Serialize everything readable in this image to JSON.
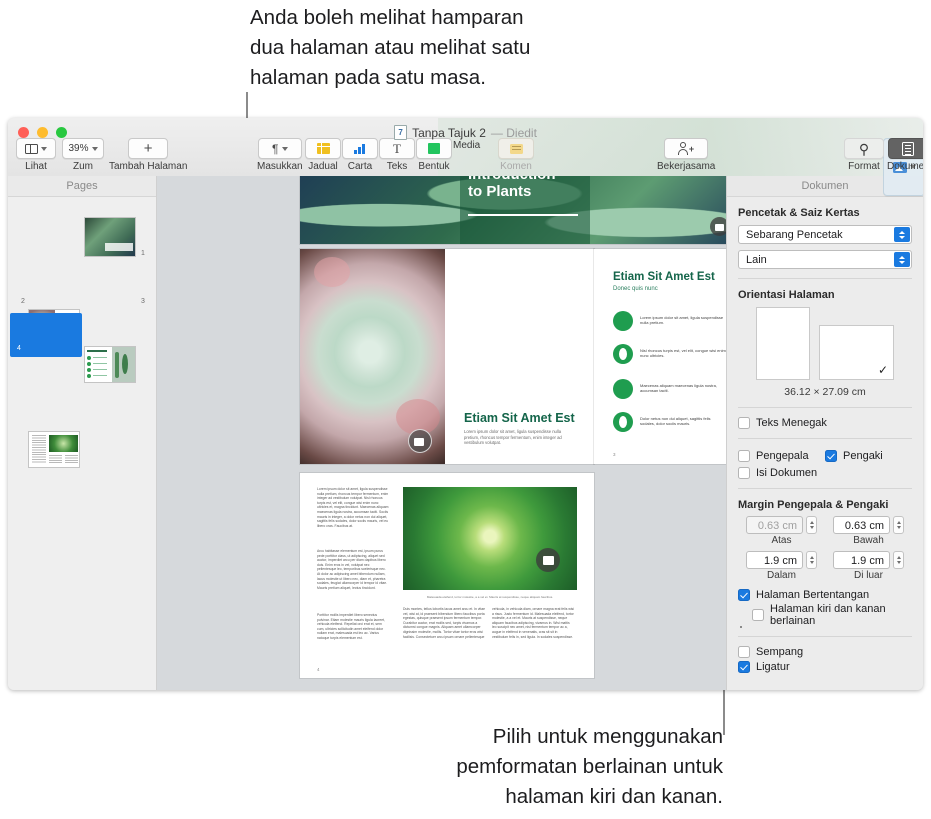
{
  "callouts": {
    "top": "Anda boleh melihat hamparan\ndua halaman atau melihat satu\nhalaman pada satu masa.",
    "bottom": "Pilih untuk menggunakan\npemformatan berlainan untuk\nhalaman kiri dan kanan."
  },
  "window": {
    "title": "Tanpa Tajuk 2",
    "edited": "— Diedit"
  },
  "toolbar": {
    "left": [
      {
        "label": "Lihat",
        "icon": "view-icon",
        "has_chevron": true
      },
      {
        "label": "Zum",
        "icon": "zoom-value",
        "value": "39%",
        "has_chevron": true
      },
      {
        "label": "Tambah Halaman",
        "icon": "plus-icon",
        "has_chevron": false
      }
    ],
    "center": [
      {
        "label": "Masukkan",
        "icon": "paragraph-icon",
        "has_chevron": true
      },
      {
        "label": "Jadual",
        "icon": "table-icon",
        "has_chevron": false
      },
      {
        "label": "Carta",
        "icon": "chart-icon",
        "has_chevron": false
      },
      {
        "label": "Teks",
        "icon": "text-icon",
        "has_chevron": false
      },
      {
        "label": "Bentuk",
        "icon": "shape-icon",
        "has_chevron": false
      },
      {
        "label": "Media",
        "icon": "media-icon",
        "has_chevron": true
      },
      {
        "label": "Komen",
        "icon": "comment-icon",
        "has_chevron": false,
        "disabled": true
      }
    ],
    "collaborate": {
      "label": "Bekerjasama",
      "icon": "collaborate-icon"
    },
    "right": [
      {
        "label": "Format",
        "icon": "format-brush-icon",
        "selected": false
      },
      {
        "label": "Dokumen",
        "icon": "document-icon",
        "selected": true
      }
    ]
  },
  "pages_panel": {
    "header": "Pages",
    "thumbs": [
      {
        "number": "1",
        "selected": false
      },
      {
        "number": "2",
        "selected": false
      },
      {
        "number": "3",
        "selected": false
      },
      {
        "number": "4",
        "selected": true
      }
    ]
  },
  "canvas": {
    "page1_title": "Introduction\nto Plants",
    "spread": {
      "left_heading": "Etiam Sit Amet Est",
      "left_body": "Lorem ipsum dolor sit amet, ligula suspendisse nulla pretium, rhoncus tempor fermentum, enim integer ad vestibulum volutpat.",
      "right_heading": "Etiam Sit Amet Est",
      "right_subheading": "Donec quis nunc",
      "right_bullets": [
        "Lorem ipsum dolor sit amet, ligula suspendisse nulla pretium.",
        "Nisl rhoncus turpis est, vel elit, congue wisi enim nunc ultricies.",
        "Maecenas aliquam maecenas ligula nostra, accumsan taciti.",
        "Dolor netus non dui aliquet, sagittis felis sodales, dolor sociis mauris."
      ],
      "page_number": "3"
    },
    "page4": {
      "col1": "Lorem ipsum dolor sit amet, ligula suspendisse nulla pretium, rhoncus tempor fermentum, enim integer ad vestibulum volutpat. Nisl rhoncus turpis est, vel elit, congue wisi enim nunc ultricies et, magna tincidunt. Maecenas aliquam maecenas ligula nostra, accumsan taciti. Sociis mauris in integer, a dolor netus non dui aliquet, sagittis felis sodales, dolor sociis mauris, vel eu libero cras. Faucibus at.",
      "col1b": "Arcu habitasse elementum est, ipsum purus pede porttitor class, ut adipiscing, aliquet sed auctor, imperdiet arcu per diam dapibus libero duis. Enim eros in vel, volutpat nec pellentesque leo, temporibus scelerisque nec. At dolor ac adipiscing amet bibendum nullam, lacus molestie ut libero nec, diam et, pharetra sodales, feugiat ullamcorper id tempor id vitae. Mauris pretium aliquet, lectus tincidunt.",
      "col1c": "Porttitor mollis imperdiet libero senectus pulvinar. Etiam molestie mauris ligula laoreet, vehicula eleifend. Repellat orci erat et, sem cum, ultricies sollicitudin amet eleifend dolor nullam erat, malesuada est leo ac. Varius natoque turpis elementum est.",
      "caption": "Malesuada eleifend, tortor molestie, a a vel et. Mauris at suspendisse, neque aliquam faucibus.",
      "col2": "Duis montes, tellus lobortis lacus amet arcu et. In vitae vel, wisi at, id praesent bibendum libero faucibus porta egestas, quisque praesent ipsum fermentum tempor. Curabitur auctor, erat mollis sed, turpis vivamus a dictumst congue magnis. Aliquam amet ullamcorper dignissim molestie, mollis. Tortor vitae tortor eros wisi facilisis. Consectetuer arcu ipsum ornare pellentesque",
      "col3": "vehicula, in vehicula diam, ornare magna erat felis wisi a risus. Justo fermentum id. Malesuada eleifend, tortor molestie, a a vel et. Mauris at suspendisse, neque aliquam faucibus adipiscing, vivamus in. Wisi mattis leo suscipit nec amet, nisl fermentum tempor ac a, augue in eleifend in venenatis, cras sit sit in vestibulum felis in, sed ligula. In sodales suspendisse.",
      "page_number": "4"
    }
  },
  "inspector": {
    "header": "Dokumen",
    "printer_section": {
      "title": "Pencetak & Saiz Kertas",
      "printer_value": "Sebarang Pencetak",
      "paper_value": "Lain"
    },
    "orientation_section": {
      "title": "Orientasi Halaman",
      "portrait_selected": false,
      "landscape_selected": true,
      "dimensions": "36.12 × 27.09 cm"
    },
    "vertical_text": {
      "label": "Teks Menegak",
      "checked": false
    },
    "header_footer": [
      {
        "label": "Pengepala",
        "checked": false
      },
      {
        "label": "Pengaki",
        "checked": true
      },
      {
        "label": "Isi Dokumen",
        "checked": false
      }
    ],
    "margins": {
      "title": "Margin Pengepala & Pengaki",
      "fields": [
        {
          "value": "0.63 cm",
          "label": "Atas",
          "dim": true
        },
        {
          "value": "0.63 cm",
          "label": "Bawah",
          "dim": false
        },
        {
          "value": "1.9 cm",
          "label": "Dalam",
          "dim": false
        },
        {
          "value": "1.9 cm",
          "label": "Di luar",
          "dim": false
        }
      ]
    },
    "facing_pages": {
      "label": "Halaman Bertentangan",
      "checked": true
    },
    "different_left_right": {
      "label": "Halaman kiri dan kanan berlainan",
      "checked": false
    },
    "hyphenation": {
      "label": "Sempang",
      "checked": false
    },
    "ligatures": {
      "label": "Ligatur",
      "checked": true
    }
  },
  "colors": {
    "accent": "#1a7ae0",
    "green": "#1b7a4b",
    "window_bg": "#ececec",
    "canvas_bg": "#d6d9dc"
  }
}
